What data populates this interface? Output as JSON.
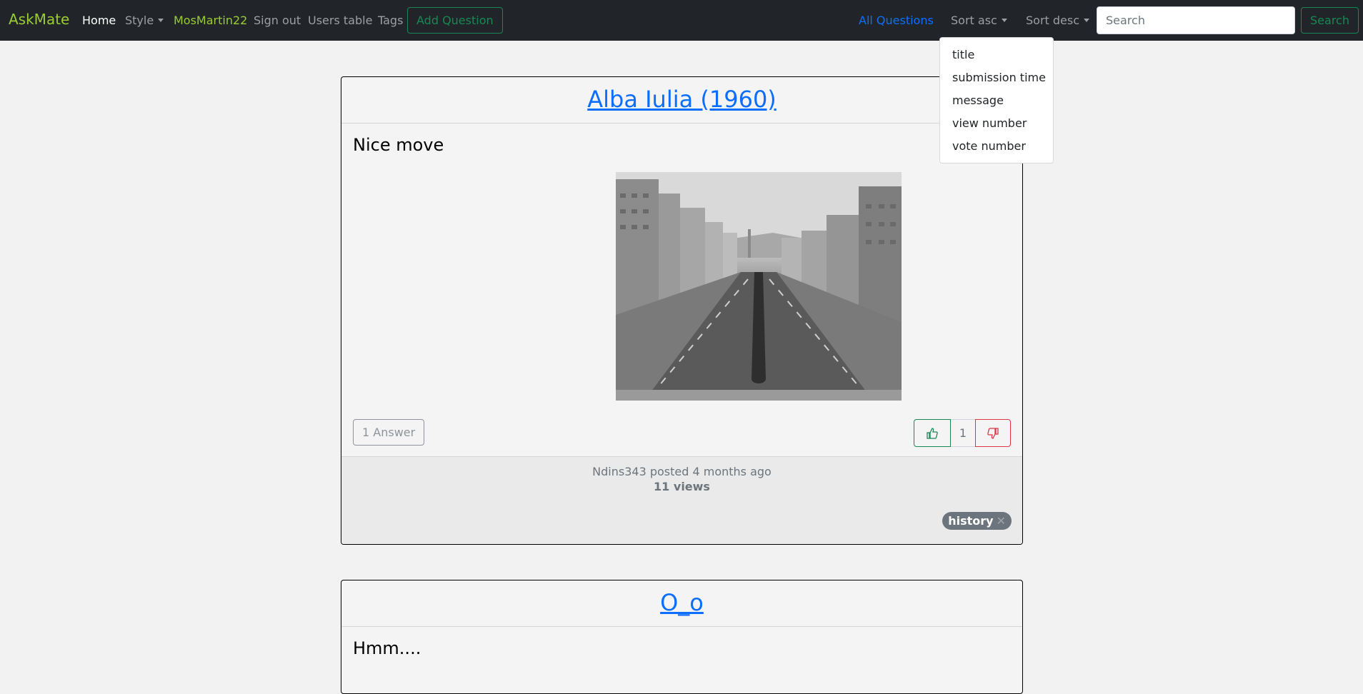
{
  "navbar": {
    "brand": "AskMate",
    "home": "Home",
    "style": "Style",
    "username": "MosMartin22",
    "sign_out": "Sign out",
    "users_table": "Users table",
    "tags": "Tags",
    "add_question": "Add Question",
    "all_questions": "All Questions",
    "sort_asc": "Sort asc",
    "sort_desc": "Sort desc",
    "search_placeholder": "Search",
    "search_button": "Search"
  },
  "sort_dropdown": {
    "items": [
      "title",
      "submission time",
      "message",
      "view number",
      "vote number"
    ]
  },
  "questions": [
    {
      "title": "Alba Iulia (1960)",
      "message": "Nice move",
      "answers_label": "1 Answer",
      "vote_count": "1",
      "meta": "Ndins343 posted 4 months ago",
      "views": "11 views",
      "tag": "history"
    },
    {
      "title": "O_o",
      "message": "Hmm...."
    }
  ],
  "colors": {
    "navbar_bg": "#212529",
    "brand": "#9acd32",
    "link_blue": "#0d6efd",
    "success_green": "#198754",
    "danger_red": "#dc3545"
  }
}
